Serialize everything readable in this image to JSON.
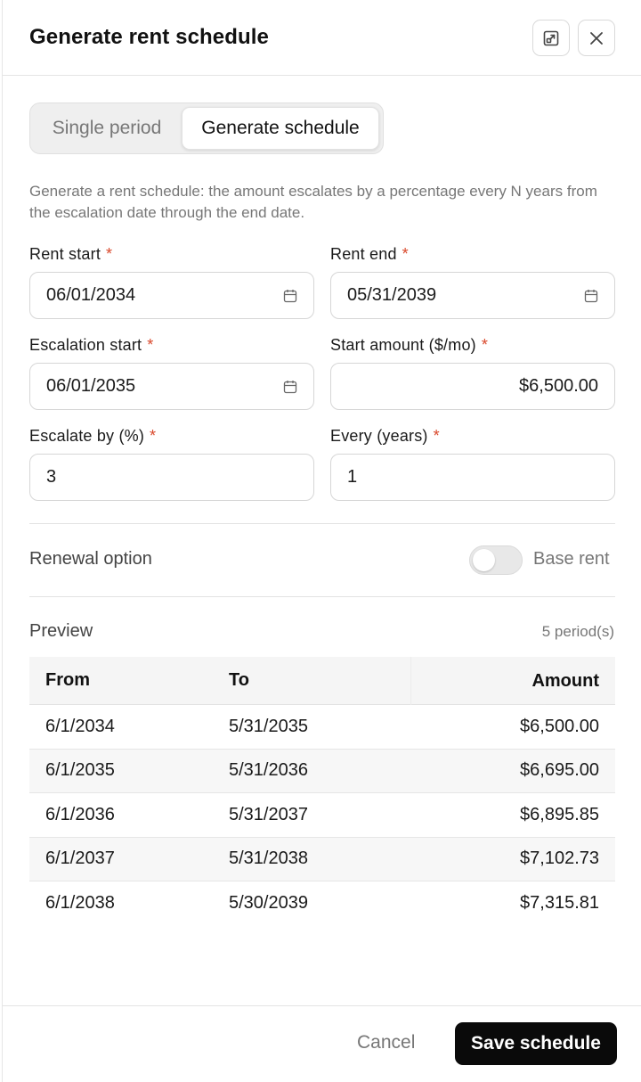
{
  "header": {
    "title": "Generate rent schedule"
  },
  "mode_toggle": {
    "single_label": "Single period",
    "generate_label": "Generate schedule",
    "selected": "Generate schedule"
  },
  "description": "Generate a rent schedule: the amount escalates by a percentage every N years from the escalation date through the end date.",
  "form": {
    "required_marker": "*",
    "rent_start": {
      "label": "Rent start",
      "value": "06/01/2034"
    },
    "rent_end": {
      "label": "Rent end",
      "value": "05/31/2039"
    },
    "escalation_start": {
      "label": "Escalation start",
      "value": "06/01/2035"
    },
    "start_amount": {
      "label": "Start amount ($/mo)",
      "value": "$6,500.00"
    },
    "escalate_by": {
      "label": "Escalate by (%)",
      "value": "3"
    },
    "every_years": {
      "label": "Every (years)",
      "value": "1"
    }
  },
  "renewal": {
    "label": "Renewal option",
    "toggle_on": false,
    "toggle_label": "Base rent"
  },
  "preview": {
    "label": "Preview",
    "count": "5 period(s)",
    "columns": [
      "From",
      "To",
      "Amount"
    ],
    "rows": [
      {
        "from": "6/1/2034",
        "to": "5/31/2035",
        "amount": "$6,500.00"
      },
      {
        "from": "6/1/2035",
        "to": "5/31/2036",
        "amount": "$6,695.00"
      },
      {
        "from": "6/1/2036",
        "to": "5/31/2037",
        "amount": "$6,895.85"
      },
      {
        "from": "6/1/2037",
        "to": "5/31/2038",
        "amount": "$7,102.73"
      },
      {
        "from": "6/1/2038",
        "to": "5/30/2039",
        "amount": "$7,315.81"
      }
    ]
  },
  "footer": {
    "cancel_label": "Cancel",
    "save_label": "Save schedule"
  },
  "colors": {
    "required": "#d9482b",
    "primary_button": "#0a0a0a"
  }
}
